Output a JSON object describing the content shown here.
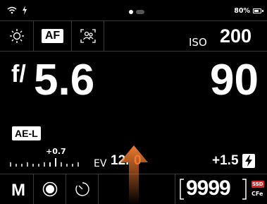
{
  "status": {
    "battery_percent": "80%",
    "battery_level": 0.8,
    "icons": [
      "wifi-icon",
      "usb-charge-icon"
    ],
    "pages": {
      "current": 1,
      "total": 2
    }
  },
  "top_row": {
    "icons": [
      "brightness-icon",
      "face-detect-icon"
    ],
    "af_label": "AF",
    "iso_label": "ISO",
    "iso_value": "200"
  },
  "exposure": {
    "f_prefix": "f/",
    "aperture": "5.6",
    "shutter": "90"
  },
  "ae_lock_label": "AE-L",
  "ev": {
    "offset": "+0.7",
    "label": "EV",
    "value": "12.",
    "value_tail": "0",
    "flash_comp": "+1.5",
    "flash_icon": "flash-icon"
  },
  "bottom_row": {
    "mode": "M",
    "icons": [
      "record-icon",
      "self-timer-icon"
    ],
    "shots_remaining": "9999",
    "card_badge": "SSD",
    "card_type": "CFe"
  },
  "colors": {
    "background": "#000000",
    "accent_orange": "#e8762b",
    "card_red": "#e0202a"
  }
}
